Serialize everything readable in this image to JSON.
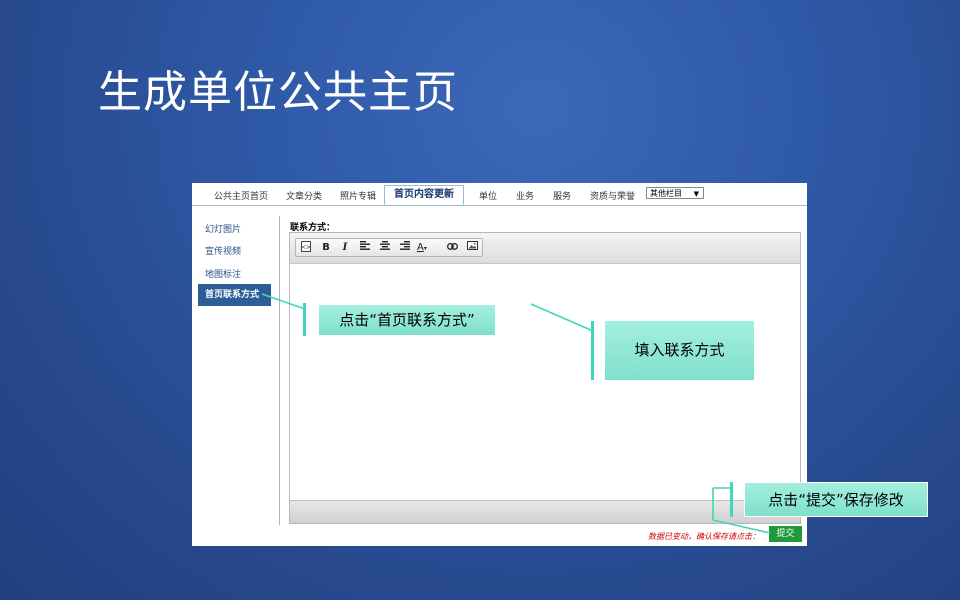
{
  "slide": {
    "title": "生成单位公共主页"
  },
  "tabs": [
    {
      "label": "公共主页首页"
    },
    {
      "label": "文章分类"
    },
    {
      "label": "照片专辑"
    },
    {
      "label": "首页内容更新"
    },
    {
      "label": "单位"
    },
    {
      "label": "业务"
    },
    {
      "label": "服务"
    },
    {
      "label": "资质与荣誉"
    }
  ],
  "tab_select": {
    "value": "其他栏目"
  },
  "sidebar": {
    "items": [
      {
        "label": "幻灯图片"
      },
      {
        "label": "宣传视频"
      },
      {
        "label": "地图标注"
      },
      {
        "label": "首页联系方式"
      }
    ]
  },
  "form": {
    "field_label": "联系方式：",
    "warning": "数据已变动，确认保存请点击：",
    "submit_label": "提交"
  },
  "toolbar": {
    "buttons": [
      "source",
      "bold",
      "italic",
      "align-left",
      "align-center",
      "align-right",
      "font-color",
      "link",
      "image"
    ],
    "bold_glyph": "B",
    "italic_glyph": "I",
    "color_glyph": "A"
  },
  "callouts": {
    "click_contact": "点击“首页联系方式”",
    "fill_contact": "填入联系方式",
    "click_submit": "点击“提交”保存修改"
  },
  "colors": {
    "background": "#2f5aa8",
    "callout": "#8fe8d4",
    "connector": "#3fd6bb",
    "active_sidebar": "#2c5d96",
    "submit": "#1e9a3a",
    "warning": "#cc0000"
  }
}
